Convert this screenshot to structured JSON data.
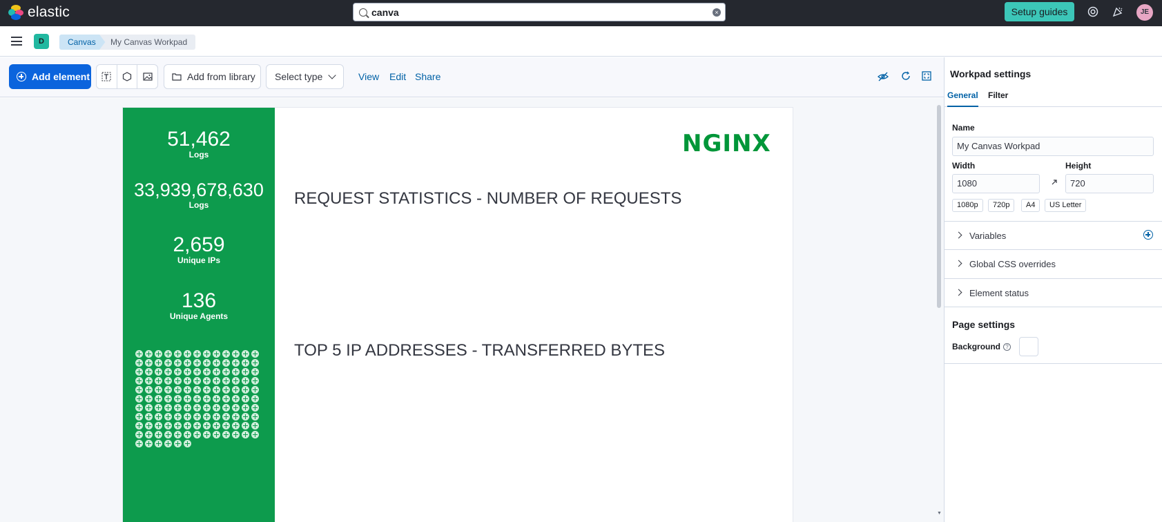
{
  "app": {
    "brand": "elastic"
  },
  "search": {
    "value": "canva"
  },
  "header": {
    "setup_guides": "Setup guides",
    "avatar_initials": "JE"
  },
  "nav": {
    "space_initial": "D",
    "breadcrumbs": [
      "Canvas",
      "My Canvas Workpad"
    ]
  },
  "toolbar": {
    "add_element": "Add element",
    "add_from_library": "Add from library",
    "select_type": "Select type",
    "view": "View",
    "edit": "Edit",
    "share": "Share"
  },
  "workpad": {
    "metrics": [
      {
        "value": "51,462",
        "label": "Logs"
      },
      {
        "value": "33,939,678,630",
        "label": "Logs"
      },
      {
        "value": "2,659",
        "label": "Unique IPs"
      },
      {
        "value": "136",
        "label": "Unique Agents"
      }
    ],
    "logo_text": "NGINX",
    "section_titles": [
      "REQUEST STATISTICS - NUMBER OF REQUESTS",
      "TOP 5 IP ADDRESSES - TRANSFERRED BYTES"
    ],
    "icon_grid_count": 136
  },
  "sidebar": {
    "title": "Workpad settings",
    "tabs": [
      "General",
      "Filter"
    ],
    "name_label": "Name",
    "name_value": "My Canvas Workpad",
    "width_label": "Width",
    "width_value": "1080",
    "height_label": "Height",
    "height_value": "720",
    "presets": [
      "1080p",
      "720p",
      "A4",
      "US Letter"
    ],
    "accordions": [
      "Variables",
      "Global CSS overrides",
      "Element status"
    ],
    "page_settings": "Page settings",
    "background_label": "Background"
  },
  "colors": {
    "brand_teal": "#3cc6b8",
    "primary": "#0b64dd",
    "workpad_green": "#0d9b4d",
    "nginx_green": "#009639"
  }
}
